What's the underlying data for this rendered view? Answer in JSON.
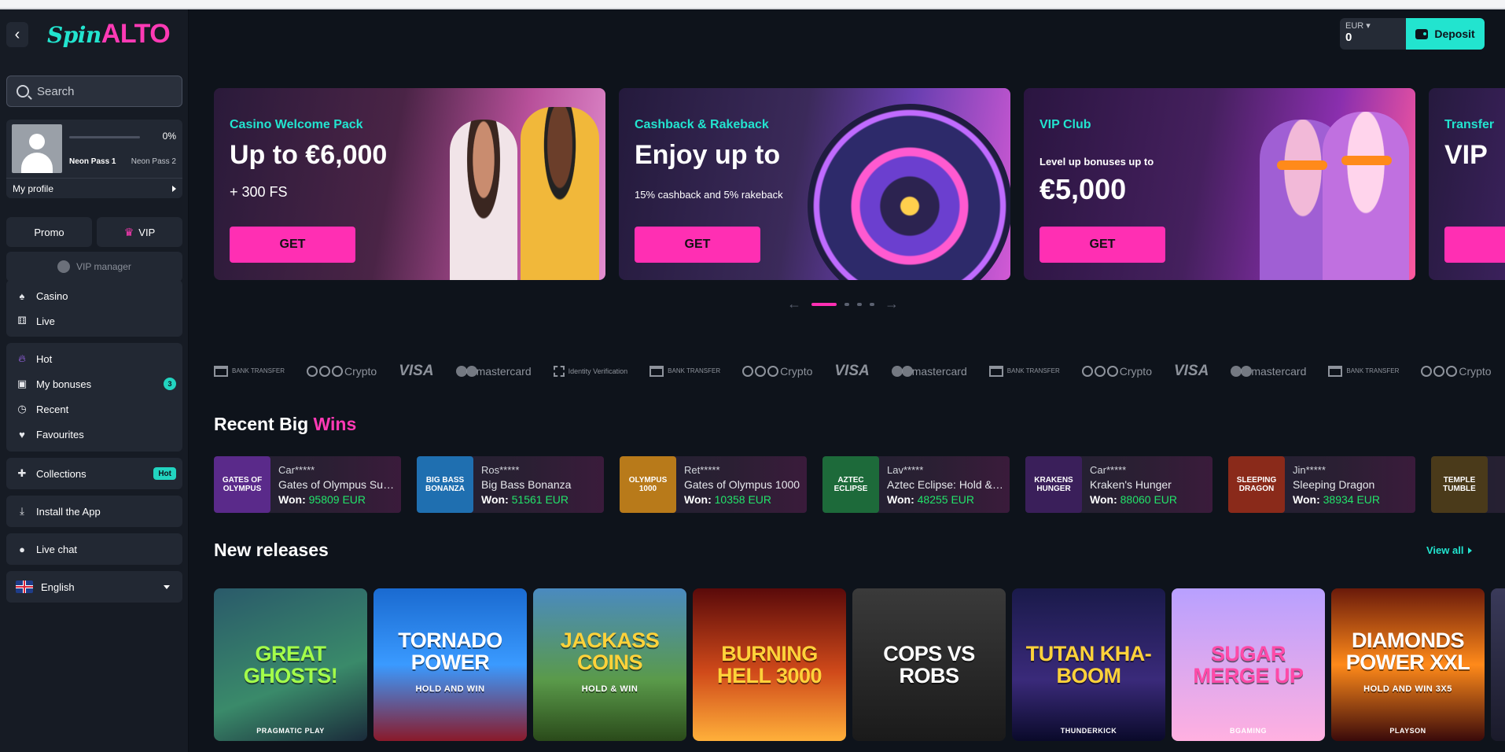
{
  "brand": {
    "logo_spin": "Spin",
    "logo_alto": "ALTO"
  },
  "sidebar": {
    "back_label": "<",
    "search_placeholder": "Search",
    "profile": {
      "progress_pct": "0%",
      "progress_value": 0,
      "pass_current": "Neon Pass 1",
      "pass_next": "Neon Pass 2",
      "my_profile": "My profile"
    },
    "promo": "Promo",
    "vip": "VIP",
    "vip_manager": "VIP manager",
    "group1": [
      {
        "label": "Casino",
        "icon": "casino-icon"
      },
      {
        "label": "Live",
        "icon": "dice-icon"
      }
    ],
    "group2": [
      {
        "label": "Hot",
        "icon": "flame-icon"
      },
      {
        "label": "My bonuses",
        "icon": "gift-icon",
        "badge": "3"
      },
      {
        "label": "Recent",
        "icon": "clock-icon"
      },
      {
        "label": "Favourites",
        "icon": "heart-icon"
      }
    ],
    "collections": {
      "label": "Collections",
      "badge": "Hot"
    },
    "install_app": "Install the App",
    "live_chat": "Live chat",
    "language": "English"
  },
  "header": {
    "currency": "EUR",
    "balance": "0",
    "deposit": "Deposit"
  },
  "banners": [
    {
      "eyebrow": "Casino Welcome Pack",
      "title": "Up to €6,000",
      "subtitle": "+ 300 FS",
      "cta": "GET"
    },
    {
      "eyebrow": "Cashback & Rakeback",
      "title": "Enjoy up to",
      "subtitle": "15% cashback and 5% rakeback",
      "cta": "GET"
    },
    {
      "eyebrow": "VIP Club",
      "subtitle": "Level up bonuses up to",
      "title": "€5,000",
      "cta": "GET"
    },
    {
      "eyebrow": "Transfer",
      "title": "VIP"
    }
  ],
  "carousel": {
    "prev": "←",
    "next": "→",
    "active_index": 0,
    "count": 4
  },
  "payments": [
    {
      "type": "bank",
      "label": "BANK TRANSFER"
    },
    {
      "type": "crypto",
      "label": "Crypto"
    },
    {
      "type": "visa",
      "label": "VISA"
    },
    {
      "type": "master",
      "label": "mastercard"
    },
    {
      "type": "idv",
      "label": "Identity Verification"
    },
    {
      "type": "bank",
      "label": "BANK TRANSFER"
    },
    {
      "type": "crypto",
      "label": "Crypto"
    },
    {
      "type": "visa",
      "label": "VISA"
    },
    {
      "type": "master",
      "label": "mastercard"
    },
    {
      "type": "bank",
      "label": "BANK TRANSFER"
    },
    {
      "type": "crypto",
      "label": "Crypto"
    },
    {
      "type": "visa",
      "label": "VISA"
    },
    {
      "type": "master",
      "label": "mastercard"
    },
    {
      "type": "bank",
      "label": "BANK TRANSFER"
    },
    {
      "type": "crypto",
      "label": "Crypto"
    }
  ],
  "recent_wins": {
    "title_main": "Recent Big ",
    "title_accent": "Wins",
    "won_label": "Won:",
    "items": [
      {
        "user": "Car*****",
        "game": "Gates of Olympus Super Scatter",
        "amount": "95809 EUR",
        "thumb": "GATES OF OLYMPUS",
        "color": "#5a2a8a"
      },
      {
        "user": "Ros*****",
        "game": "Big Bass Bonanza",
        "amount": "51561 EUR",
        "thumb": "BIG BASS BONANZA",
        "color": "#1f6fb0"
      },
      {
        "user": "Ret*****",
        "game": "Gates of Olympus 1000",
        "amount": "10358 EUR",
        "thumb": "OLYMPUS 1000",
        "color": "#b87a1a"
      },
      {
        "user": "Lav*****",
        "game": "Aztec Eclipse: Hold & Win",
        "amount": "48255 EUR",
        "thumb": "AZTEC ECLIPSE",
        "color": "#1d6a3a"
      },
      {
        "user": "Car*****",
        "game": "Kraken's Hunger",
        "amount": "88060 EUR",
        "thumb": "KRAKENS HUNGER",
        "color": "#3a1f5a"
      },
      {
        "user": "Jin*****",
        "game": "Sleeping Dragon",
        "amount": "38934 EUR",
        "thumb": "SLEEPING DRAGON",
        "color": "#8a2a1a"
      },
      {
        "user": "",
        "game": "",
        "amount": "",
        "thumb": "TEMPLE TUMBLE",
        "color": "#4a3a1a"
      }
    ]
  },
  "new_releases": {
    "title": "New releases",
    "view_all": "View all",
    "games": [
      {
        "name": "Great Ghosts!",
        "provider": "PRAGMATIC PLAY",
        "bg": "linear-gradient(160deg,#2a5a6a,#3a8a6a 60%,#1a2a3a)",
        "color": "#a4ff4a"
      },
      {
        "name": "Tornado Power",
        "sub": "HOLD AND WIN",
        "provider": "",
        "bg": "linear-gradient(180deg,#1a6ad0,#3a9aff 50%,#8a1a2a)",
        "color": "#ffffff"
      },
      {
        "name": "Jackass Coins",
        "sub": "HOLD & WIN",
        "provider": "",
        "bg": "linear-gradient(180deg,#4a8ac0,#5a9a4a 60%,#2a4a1a)",
        "color": "#ffd23a"
      },
      {
        "name": "Burning Hell 3000",
        "provider": "",
        "bg": "linear-gradient(180deg,#5a0a0a,#d04a1a 55%,#ffb03a)",
        "color": "#ffd23a"
      },
      {
        "name": "Cops vs Robs",
        "provider": "",
        "bg": "linear-gradient(180deg,#3a3a3a,#1a1a1a)",
        "color": "#ffffff"
      },
      {
        "name": "Tutan Kha-Boom",
        "provider": "THUNDERKICK",
        "bg": "linear-gradient(180deg,#1a1a4a,#3a2a7a 60%,#0a0a2a)",
        "color": "#ffd23a"
      },
      {
        "name": "Sugar Merge Up",
        "provider": "BGAMING",
        "bg": "linear-gradient(180deg,#b8a0ff,#ffb0e0)",
        "color": "#ff4aa8"
      },
      {
        "name": "Diamonds Power XXL",
        "sub": "HOLD AND WIN 3X5",
        "provider": "PLAYSON",
        "bg": "linear-gradient(180deg,#6a1a0a,#ff8a1a 50%,#3a0a0a)",
        "color": "#ffffff"
      },
      {
        "name": "",
        "provider": "",
        "bg": "linear-gradient(180deg,#3a3a5a,#1a1a2a)",
        "color": "#ffffff"
      }
    ]
  },
  "colors": {
    "accent_pink": "#ff2fb3",
    "accent_teal": "#22e4cf",
    "win_green": "#22e46a",
    "bg": "#0e131b",
    "sidebar_bg": "#161b24"
  }
}
